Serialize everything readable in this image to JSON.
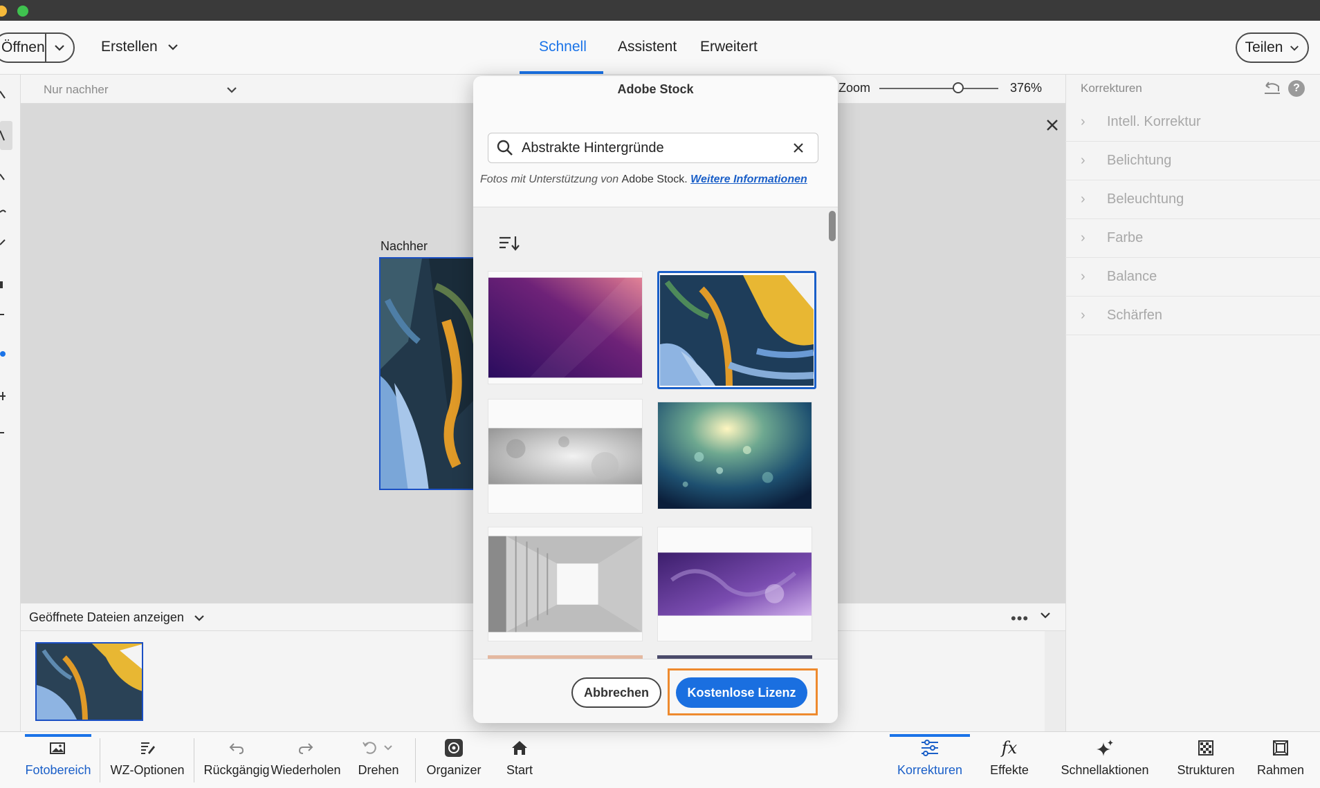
{
  "topbar": {
    "open_label": "Öffnen",
    "create_label": "Erstellen",
    "modes": [
      "Schnell",
      "Assistent",
      "Erweitert"
    ],
    "active_mode": "Schnell",
    "share_label": "Teilen"
  },
  "options": {
    "view_select": "Nur nachher",
    "zoom_label": "Zoom",
    "zoom_value": "376%",
    "zoom_fraction": 0.62
  },
  "canvas": {
    "after_label": "Nachher"
  },
  "right_panel": {
    "title": "Korrekturen",
    "items": [
      "Intell. Korrektur",
      "Belichtung",
      "Beleuchtung",
      "Farbe",
      "Balance",
      "Schärfen"
    ]
  },
  "photo_bin": {
    "label": "Geöffnete Dateien anzeigen",
    "more": "•••"
  },
  "bottom_bar": {
    "left": [
      "Fotobereich",
      "WZ-Optionen",
      "Rückgängig",
      "Wiederholen",
      "Drehen",
      "Organizer",
      "Start"
    ],
    "right": [
      "Korrekturen",
      "Effekte",
      "Schnellaktionen",
      "Strukturen",
      "Rahmen"
    ],
    "active_left": "Fotobereich",
    "active_right": "Korrekturen"
  },
  "modal": {
    "title": "Adobe Stock",
    "search_value": "Abstrakte Hintergründe",
    "powered_prefix": "Fotos mit Unterstützung von ",
    "powered_brand": "Adobe Stock.",
    "more_info_link": "Weitere Informationen",
    "cancel_label": "Abbrechen",
    "license_label": "Kostenlose Lizenz",
    "selected_tile": 2,
    "tiles": [
      {
        "name": "purple-gradient",
        "colors": [
          "#3a1266",
          "#8a2e7c",
          "#d56a8a"
        ]
      },
      {
        "name": "abstract-paint",
        "colors": [
          "#1e3d5a",
          "#e8b733",
          "#7faad9"
        ]
      },
      {
        "name": "grey-texture",
        "colors": [
          "#9a9a9a",
          "#e8e8e8",
          "#bdbdbd"
        ]
      },
      {
        "name": "bokeh-light",
        "colors": [
          "#0e2c4c",
          "#3e8a88",
          "#f2e8a0"
        ]
      },
      {
        "name": "white-tunnel",
        "colors": [
          "#8c8c8c",
          "#f4f4f4",
          "#b8b8b8"
        ]
      },
      {
        "name": "purple-grunge",
        "colors": [
          "#3c1e6c",
          "#8a5ac0",
          "#c6a6e0"
        ]
      }
    ]
  },
  "colors": {
    "accent": "#1a73e8",
    "selection_border": "#1a4fc4",
    "highlight": "#ee8a2e"
  }
}
